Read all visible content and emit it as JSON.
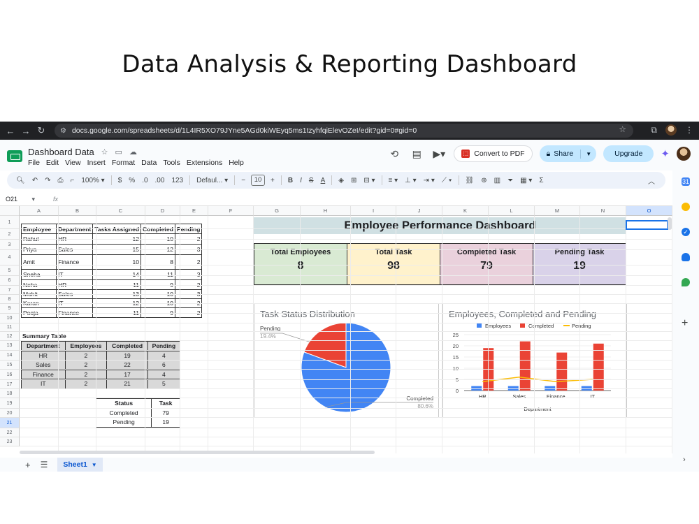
{
  "slide_title": "Data Analysis & Reporting Dashboard",
  "browser": {
    "url": "docs.google.com/spreadsheets/d/1L4IR5XO79JYne5AGd0kiWEyq5ms1tzyhfqiElevOZeI/edit?gid=0#gid=0"
  },
  "sheets": {
    "doc_title": "Dashboard Data",
    "menu": [
      "File",
      "Edit",
      "View",
      "Insert",
      "Format",
      "Data",
      "Tools",
      "Extensions",
      "Help"
    ],
    "convert_pdf": "Convert to PDF",
    "share": "Share",
    "upgrade": "Upgrade"
  },
  "toolbar": {
    "zoom": "100%",
    "currency": "$",
    "percent": "%",
    "dec_less": ".0",
    "dec_more": ".00",
    "num_format": "123",
    "font": "Defaul...",
    "font_size": "10"
  },
  "formula": {
    "cell_ref": "O21",
    "fx": "fx"
  },
  "columns": [
    "A",
    "B",
    "C",
    "D",
    "E",
    "F",
    "G",
    "H",
    "I",
    "J",
    "K",
    "L",
    "M",
    "N",
    "O"
  ],
  "rows": [
    "1",
    "2",
    "3",
    "4",
    "5",
    "6",
    "7",
    "8",
    "9",
    "10",
    "11",
    "12",
    "13",
    "14",
    "15",
    "16",
    "17",
    "18",
    "19",
    "20",
    "21",
    "22",
    "23"
  ],
  "selected": {
    "column": "O",
    "row": "21"
  },
  "employee_table": {
    "headers": [
      "Employee",
      "Department",
      "Tasks Assigned",
      "Completed",
      "Pending"
    ],
    "rows": [
      [
        "Rahul",
        "HR",
        "12",
        "10",
        "2"
      ],
      [
        "Priya",
        "Sales",
        "15",
        "12",
        "3"
      ],
      [
        "Amit",
        "Finance",
        "10",
        "8",
        "2"
      ],
      [
        "Sneha",
        "IT",
        "14",
        "11",
        "3"
      ],
      [
        "Neha",
        "HR",
        "11",
        "9",
        "2"
      ],
      [
        "Mohit",
        "Sales",
        "13",
        "10",
        "3"
      ],
      [
        "Karan",
        "IT",
        "12",
        "10",
        "2"
      ],
      [
        "Pooja",
        "Finance",
        "11",
        "9",
        "2"
      ]
    ]
  },
  "summary_table": {
    "label": "Summary Table",
    "headers": [
      "Department",
      "Employees",
      "Completed",
      "Pending"
    ],
    "rows": [
      [
        "HR",
        "2",
        "19",
        "4"
      ],
      [
        "Sales",
        "2",
        "22",
        "6"
      ],
      [
        "Finance",
        "2",
        "17",
        "4"
      ],
      [
        "IT",
        "2",
        "21",
        "5"
      ]
    ]
  },
  "status_table": {
    "headers": [
      "Status",
      "Task"
    ],
    "rows": [
      [
        "Completed",
        "79"
      ],
      [
        "Pending",
        "19"
      ]
    ]
  },
  "dashboard": {
    "title": "Employee Performance Dashboard",
    "kpis": [
      {
        "label": "Total Employees",
        "value": "8",
        "color": "#d9ead3"
      },
      {
        "label": "Total Task",
        "value": "98",
        "color": "#fff2cc"
      },
      {
        "label": "Completed Task",
        "value": "79",
        "color": "#ead1dc"
      },
      {
        "label": "Pending Task",
        "value": "19",
        "color": "#d9d2e9"
      }
    ]
  },
  "sheet_tab": "Sheet1",
  "chart_data": [
    {
      "type": "pie",
      "title": "Task Status Distribution",
      "categories": [
        "Completed",
        "Pending"
      ],
      "values": [
        79,
        19
      ],
      "percent_labels": [
        "80.6%",
        "19.4%"
      ],
      "colors": [
        "#4285f4",
        "#ea4335"
      ]
    },
    {
      "type": "bar",
      "title": "Employees, Completed and Pending",
      "categories": [
        "HR",
        "Sales",
        "Finance",
        "IT"
      ],
      "xlabel": "Department",
      "ylim": [
        0,
        25
      ],
      "yticks": [
        0,
        5,
        10,
        15,
        20,
        25
      ],
      "legend": "top",
      "series": [
        {
          "name": "Employees",
          "type": "bar",
          "values": [
            2,
            2,
            2,
            2
          ],
          "color": "#4285f4"
        },
        {
          "name": "Completed",
          "type": "bar",
          "values": [
            19,
            22,
            17,
            21
          ],
          "color": "#ea4335"
        },
        {
          "name": "Pending",
          "type": "line",
          "values": [
            4,
            6,
            4,
            5
          ],
          "color": "#fbbc04"
        }
      ]
    }
  ]
}
